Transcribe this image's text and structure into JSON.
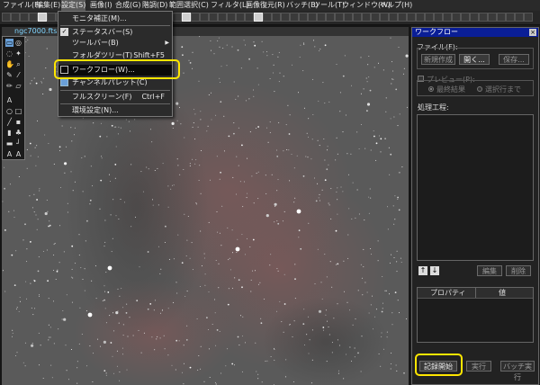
{
  "menubar": {
    "items": [
      {
        "label": "ファイル(F)",
        "name": "menu-file"
      },
      {
        "label": "編集(E)",
        "name": "menu-edit"
      },
      {
        "label": "設定(S)",
        "name": "menu-settings"
      },
      {
        "label": "画像(I)",
        "name": "menu-image"
      },
      {
        "label": "合成(G)",
        "name": "menu-composite"
      },
      {
        "label": "階調(D)",
        "name": "menu-tone"
      },
      {
        "label": "範囲選択(C)",
        "name": "menu-selection"
      },
      {
        "label": "フィルタ(L)",
        "name": "menu-filter"
      },
      {
        "label": "画像復元(R)",
        "name": "menu-restore"
      },
      {
        "label": "バッチ(B)",
        "name": "menu-batch"
      },
      {
        "label": "ツール(T)",
        "name": "menu-tools"
      },
      {
        "label": "ウィンドウ(W)",
        "name": "menu-window"
      },
      {
        "label": "ヘルプ(H)",
        "name": "menu-help"
      }
    ]
  },
  "image_window": {
    "title": "ngc7000.fts"
  },
  "settings_menu": {
    "items": [
      {
        "label": "モニタ補正(M)...",
        "shortcut": "",
        "checked": false
      },
      {
        "label": "ステータスバー(S)",
        "shortcut": "",
        "checked": true
      },
      {
        "label": "ツールバー(B)",
        "shortcut": "",
        "submenu": true
      },
      {
        "label": "フォルダツリー(T)",
        "shortcut": "Shift+F5"
      },
      {
        "label": "ワークフロー(W)...",
        "shortcut": "",
        "highlighted": true
      },
      {
        "label": "チャンネルパレット(C)",
        "shortcut": ""
      },
      {
        "label": "フルスクリーン(F)",
        "shortcut": "Ctrl+F"
      },
      {
        "label": "環境設定(N)...",
        "shortcut": ""
      }
    ]
  },
  "workflow_panel": {
    "title": "ワークフロー",
    "close": "×",
    "file_group_label": "ファイル(F):",
    "btn_new": "新規作成",
    "btn_open": "開く...",
    "btn_save": "保存...",
    "preview_label": "プレビュー(P):",
    "radio_final": "最終結果",
    "radio_selected": "選択行まで",
    "steps_label": "処理工程:",
    "up_arrow": "↑",
    "down_arrow": "↓",
    "btn_edit": "編集",
    "btn_delete": "削除",
    "prop_col_property": "プロパティ",
    "prop_col_value": "値",
    "btn_record": "記録開始",
    "btn_run": "実行",
    "btn_batch_run": "バッチ実行"
  },
  "colors": {
    "highlight": "#ffe600",
    "panel_title": "#0a1e96",
    "nebula": "#8a5a5a"
  }
}
